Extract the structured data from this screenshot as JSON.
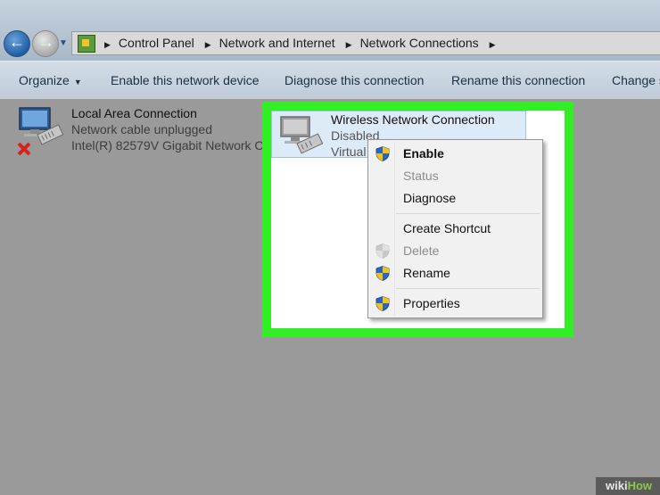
{
  "breadcrumb": {
    "items": [
      "Control Panel",
      "Network and Internet",
      "Network Connections"
    ]
  },
  "toolbar": {
    "organize": "Organize",
    "enable": "Enable this network device",
    "diagnose": "Diagnose this connection",
    "rename": "Rename this connection",
    "change": "Change s"
  },
  "connections": [
    {
      "name": "Local Area Connection",
      "status": "Network cable unplugged",
      "device": "Intel(R) 82579V Gigabit Network C...",
      "icon": "wired-network-disconnected-icon"
    },
    {
      "name": "Wireless Network Connection",
      "status": "Disabled",
      "device": "Virtual",
      "icon": "wireless-network-icon"
    }
  ],
  "context_menu": {
    "items": [
      {
        "label": "Enable",
        "default": true,
        "disabled": false,
        "shield": true
      },
      {
        "label": "Status",
        "default": false,
        "disabled": true,
        "shield": false
      },
      {
        "label": "Diagnose",
        "default": false,
        "disabled": false,
        "shield": false
      },
      {
        "label": "Create Shortcut",
        "default": false,
        "disabled": false,
        "shield": false
      },
      {
        "label": "Delete",
        "default": false,
        "disabled": true,
        "shield": true
      },
      {
        "label": "Rename",
        "default": false,
        "disabled": false,
        "shield": true
      },
      {
        "label": "Properties",
        "default": false,
        "disabled": false,
        "shield": true
      }
    ]
  },
  "highlight_color": "#31ee25",
  "watermark": {
    "prefix": "wiki",
    "suffix": "How"
  }
}
